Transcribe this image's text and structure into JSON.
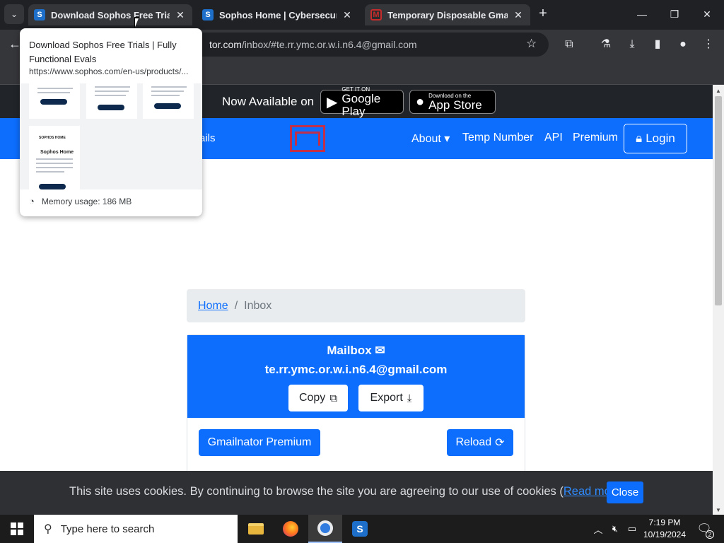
{
  "browser": {
    "tabs": [
      {
        "title": "Download Sophos Free Trials |",
        "favicon": "S"
      },
      {
        "title": "Sophos Home | Cybersecurity",
        "favicon": "S"
      },
      {
        "title": "Temporary Disposable Gmail |",
        "favicon": "M"
      }
    ],
    "address": {
      "host": "tor.com",
      "path": "/inbox/#te.rr.ymc.or.w.i.n6.4@gmail.com"
    },
    "hovercard": {
      "title": "Download Sophos Free Trials | Fully Functional Evals",
      "url": "https://www.sophos.com/en-us/products/...",
      "memory": "Memory usage: 186 MB",
      "preview_heading": "Sophos Home",
      "preview_brand": "SOPHOS HOME"
    }
  },
  "site": {
    "available_text": "Now Available on",
    "google_play": {
      "small": "GET IT ON",
      "big": "Google Play"
    },
    "app_store": {
      "small": "Download on the",
      "big": "App Store"
    },
    "brand_fragment": "ails",
    "nav": {
      "about": "About",
      "temp_number": "Temp Number",
      "api": "API",
      "premium": "Premium",
      "login": "Login"
    },
    "breadcrumb": {
      "home": "Home",
      "separator": "/",
      "current": "Inbox"
    },
    "mailbox": {
      "heading": "Mailbox",
      "address": "te.rr.ymc.or.w.i.n6.4@gmail.com",
      "copy_label": "Copy",
      "export_label": "Export",
      "premium_label": "Gmailnator Premium",
      "reload_label": "Reload"
    },
    "cookie": {
      "message": "This site uses cookies. By continuing to browse the site you are agreeing to our use of cookies (",
      "link": "Read more",
      "after": ")",
      "close": "Close"
    },
    "colors": {
      "primary": "#0d6efd",
      "dark": "#212529",
      "logo_red": "#c0304a"
    }
  },
  "taskbar": {
    "search_placeholder": "Type here to search",
    "time": "7:19 PM",
    "date": "10/19/2024",
    "notification_count": "2"
  }
}
